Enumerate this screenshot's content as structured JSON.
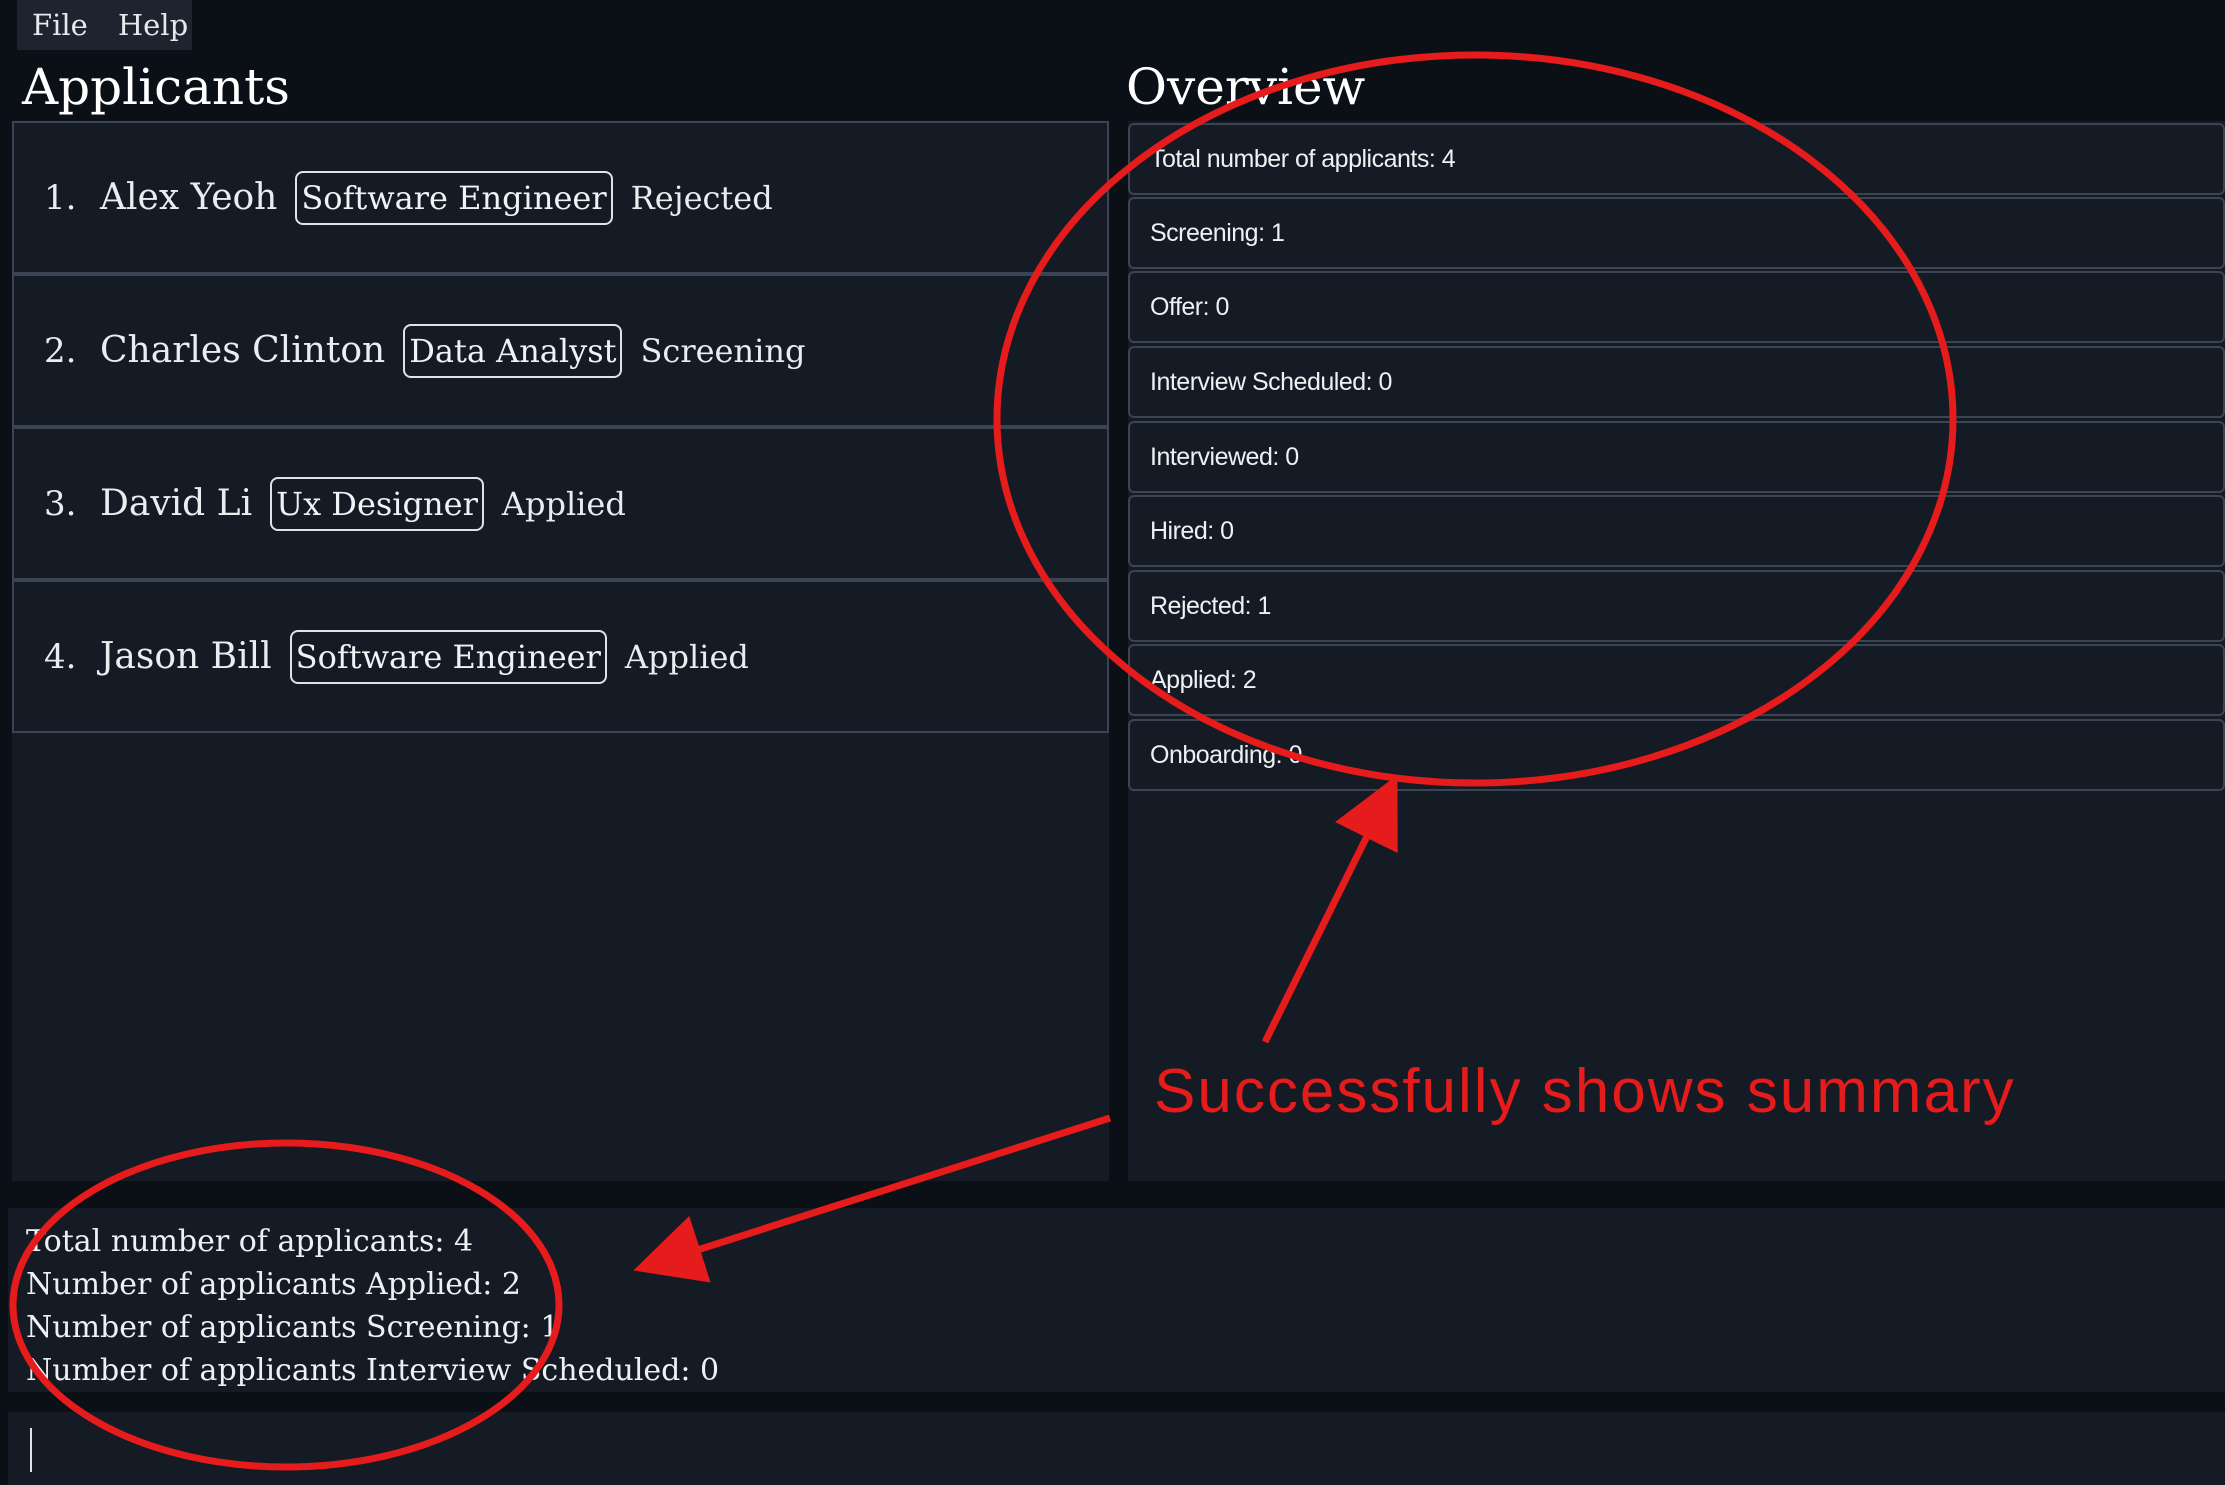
{
  "menu": {
    "file": "File",
    "help": "Help"
  },
  "applicants": {
    "title": "Applicants",
    "items": [
      {
        "index": "1.",
        "name": "Alex Yeoh",
        "role": "Software Engineer",
        "status": "Rejected"
      },
      {
        "index": "2.",
        "name": "Charles Clinton",
        "role": "Data Analyst",
        "status": "Screening"
      },
      {
        "index": "3.",
        "name": "David Li",
        "role": "Ux Designer",
        "status": "Applied"
      },
      {
        "index": "4.",
        "name": "Jason Bill",
        "role": "Software Engineer",
        "status": "Applied"
      }
    ]
  },
  "overview": {
    "title": "Overview",
    "stats": [
      "Total number of applicants: 4",
      "Screening: 1",
      "Offer: 0",
      "Interview Scheduled: 0",
      "Interviewed: 0",
      "Hired: 0",
      "Rejected: 1",
      "Applied: 2",
      "Onboarding: 0"
    ]
  },
  "result": {
    "lines": [
      "Total number of applicants: 4",
      "Number of applicants Applied: 2",
      "Number of applicants Screening: 1",
      "Number of applicants Interview Scheduled: 0"
    ]
  },
  "command": {
    "value": ""
  },
  "annotation": {
    "text": "Successfully shows summary",
    "color": "#e61b1b"
  },
  "colors": {
    "background": "#0b1017",
    "panel": "#141b24",
    "border": "#3a4452"
  }
}
